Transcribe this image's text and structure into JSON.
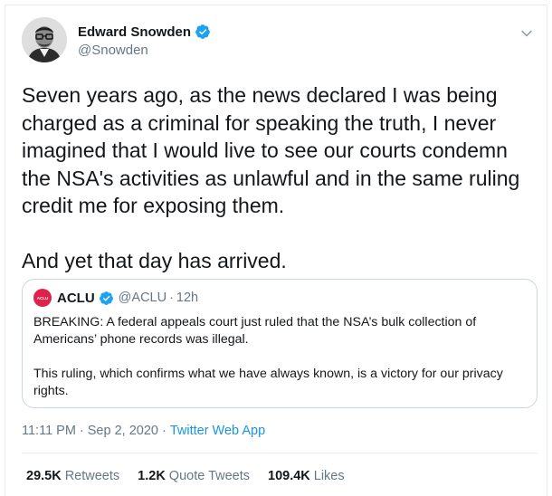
{
  "tweet": {
    "author": {
      "display_name": "Edward Snowden",
      "handle": "@Snowden",
      "verified": true,
      "verified_color": "#1da1f2"
    },
    "text": "Seven years ago, as the news declared I was being\ncharged as a criminal for speaking the truth, I never\nimagined that I would live to see our courts condemn\nthe NSA's activities as unlawful and in the same ruling\ncredit me for exposing them.\n\nAnd yet that day has arrived.",
    "quoted_tweet": {
      "author_name": "ACLU",
      "logo_text": "ACLU",
      "logo_color": "#e0224a",
      "handle": "@ACLU",
      "separator": "·",
      "time_ago": "12h",
      "paragraphs": [
        "BREAKING: A federal appeals court just ruled that the NSA’s bulk collection of Americans’ phone records was illegal.",
        "This ruling, which confirms what we have always known, is a victory for our privacy rights."
      ]
    },
    "meta": {
      "time": "11:11 PM",
      "separator": "·",
      "date": "Sep 2, 2020",
      "source": "Twitter Web App",
      "source_color": "#1b95e0"
    },
    "stats": [
      {
        "value": "29.5K",
        "label": "Retweets"
      },
      {
        "value": "1.2K",
        "label": "Quote Tweets"
      },
      {
        "value": "109.4K",
        "label": "Likes"
      }
    ],
    "icons": {
      "verified": "verified-badge-icon",
      "menu": "chevron-down-icon"
    }
  }
}
